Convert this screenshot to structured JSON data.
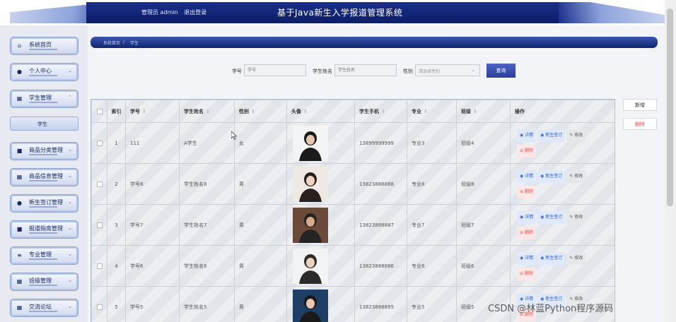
{
  "header": {
    "admin_label": "管理员 admin",
    "logout_label": "退出登录",
    "title": "基于Java新生入学报道管理系统"
  },
  "sidebar": {
    "items": [
      {
        "label": "系统首页",
        "icon": "home-icon",
        "chevron": false
      },
      {
        "label": "个人中心",
        "icon": "user-icon",
        "chevron": true
      },
      {
        "label": "学生管理",
        "icon": "grid-icon",
        "chevron": true
      },
      {
        "label": "商品分类管理",
        "icon": "box-icon",
        "chevron": true
      },
      {
        "label": "商品信息管理",
        "icon": "grid-icon",
        "chevron": true
      },
      {
        "label": "新生签订管理",
        "icon": "user-icon",
        "chevron": true
      },
      {
        "label": "报道指南管理",
        "icon": "box-icon",
        "chevron": true
      },
      {
        "label": "专业管理",
        "icon": "sliders-icon",
        "chevron": true
      },
      {
        "label": "班级管理",
        "icon": "grid-icon",
        "chevron": true
      },
      {
        "label": "交流论坛",
        "icon": "grid-icon",
        "chevron": true
      }
    ],
    "submenu_label": "学生"
  },
  "breadcrumb": {
    "home": "系统首页",
    "separator": "/",
    "current": "学生"
  },
  "search": {
    "student_no_label": "学号",
    "student_no_placeholder": "学号",
    "name_label": "学生姓名",
    "name_placeholder": "学生姓名",
    "gender_label": "性别",
    "gender_placeholder": "请选择性别",
    "query_label": "查询"
  },
  "actions": {
    "add_label": "新增",
    "delete_label": "删除"
  },
  "table": {
    "headers": [
      "索引",
      "学号",
      "学生姓名",
      "性别",
      "头像",
      "学生手机",
      "专业",
      "班级",
      "操作"
    ],
    "rows": [
      {
        "index": "1",
        "no": "111",
        "name": "A学生",
        "gender": "女",
        "phone": "13899999999",
        "major": "专业3",
        "class": "班级4"
      },
      {
        "index": "2",
        "no": "学号8",
        "name": "学生姓名8",
        "gender": "男",
        "phone": "13823888888",
        "major": "专业8",
        "class": "班级8"
      },
      {
        "index": "3",
        "no": "学号7",
        "name": "学生姓名7",
        "gender": "男",
        "phone": "13823888887",
        "major": "专业7",
        "class": "班级7"
      },
      {
        "index": "4",
        "no": "学号6",
        "name": "学生姓名6",
        "gender": "男",
        "phone": "13823888886",
        "major": "专业6",
        "class": "班级6"
      },
      {
        "index": "5",
        "no": "学号5",
        "name": "学生姓名5",
        "gender": "男",
        "phone": "13823888885",
        "major": "专业5",
        "class": "班级5"
      }
    ],
    "ops": {
      "detail": "详情",
      "sign": "新生签订",
      "edit": "修改",
      "delete": "删除"
    }
  },
  "watermark": "CSDN @林蓝Python程序源码",
  "colors": {
    "header_navy": "#0d1c66",
    "accent_blue": "#2b3f9c",
    "danger_red": "#e24d4d"
  }
}
